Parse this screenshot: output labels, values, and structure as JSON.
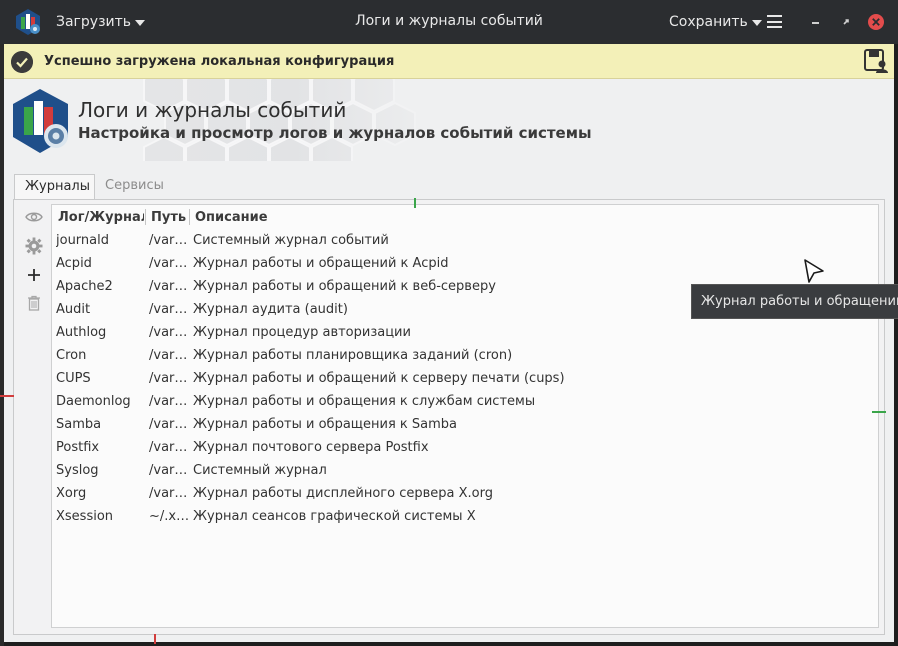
{
  "titlebar": {
    "load_label": "Загрузить",
    "title": "Логи и журналы событий",
    "save_label": "Сохранить"
  },
  "notification": {
    "text": "Успешно загружена локальная конфигурация"
  },
  "header": {
    "title": "Логи и журналы событий",
    "subtitle": "Настройка и просмотр логов и журналов событий системы"
  },
  "tabs": [
    {
      "label": "Журналы",
      "active": true
    },
    {
      "label": "Сервисы",
      "active": false
    }
  ],
  "toolbar": {
    "icons": [
      "eye-icon",
      "gear-icon",
      "plus-icon",
      "trash-icon"
    ]
  },
  "table": {
    "columns": [
      "Лог/Журнал",
      "Путь",
      "Описание"
    ],
    "rows": [
      {
        "name": "journald",
        "path": "/var…",
        "desc": "Системный журнал событий"
      },
      {
        "name": "Acpid",
        "path": "/var…",
        "desc": "Журнал работы и обращений к Acpid"
      },
      {
        "name": "Apache2",
        "path": "/var…",
        "desc": "Журнал работы и обращений к веб-серверу"
      },
      {
        "name": "Audit",
        "path": "/var…",
        "desc": "Журнал аудита (audit)"
      },
      {
        "name": "Authlog",
        "path": "/var…",
        "desc": "Журнал процедур авторизации"
      },
      {
        "name": "Cron",
        "path": "/var…",
        "desc": "Журнал работы планировщика заданий (cron)"
      },
      {
        "name": "CUPS",
        "path": "/var…",
        "desc": "Журнал работы и обращений к серверу печати (cups)"
      },
      {
        "name": "Daemonlog",
        "path": "/var…",
        "desc": "Журнал работы и обращения к службам системы"
      },
      {
        "name": "Samba",
        "path": "/var…",
        "desc": "Журнал работы и обращения к Samba"
      },
      {
        "name": "Postfix",
        "path": "/var…",
        "desc": "Журнал почтового сервера Postfix"
      },
      {
        "name": "Syslog",
        "path": "/var…",
        "desc": "Системный журнал"
      },
      {
        "name": "Xorg",
        "path": "/var…",
        "desc": "Журнал работы дисплейного сервера X.org"
      },
      {
        "name": "Xsession",
        "path": "~/.x…",
        "desc": "Журнал сеансов графической системы X"
      }
    ]
  },
  "tooltip": {
    "text": "Журнал работы и обращений к веб-серверу"
  },
  "colors": {
    "titlebar": "#2b2d30",
    "notification": "#f3f0b8",
    "close": "#e34c4c",
    "accent_green": "#3aa54a"
  }
}
